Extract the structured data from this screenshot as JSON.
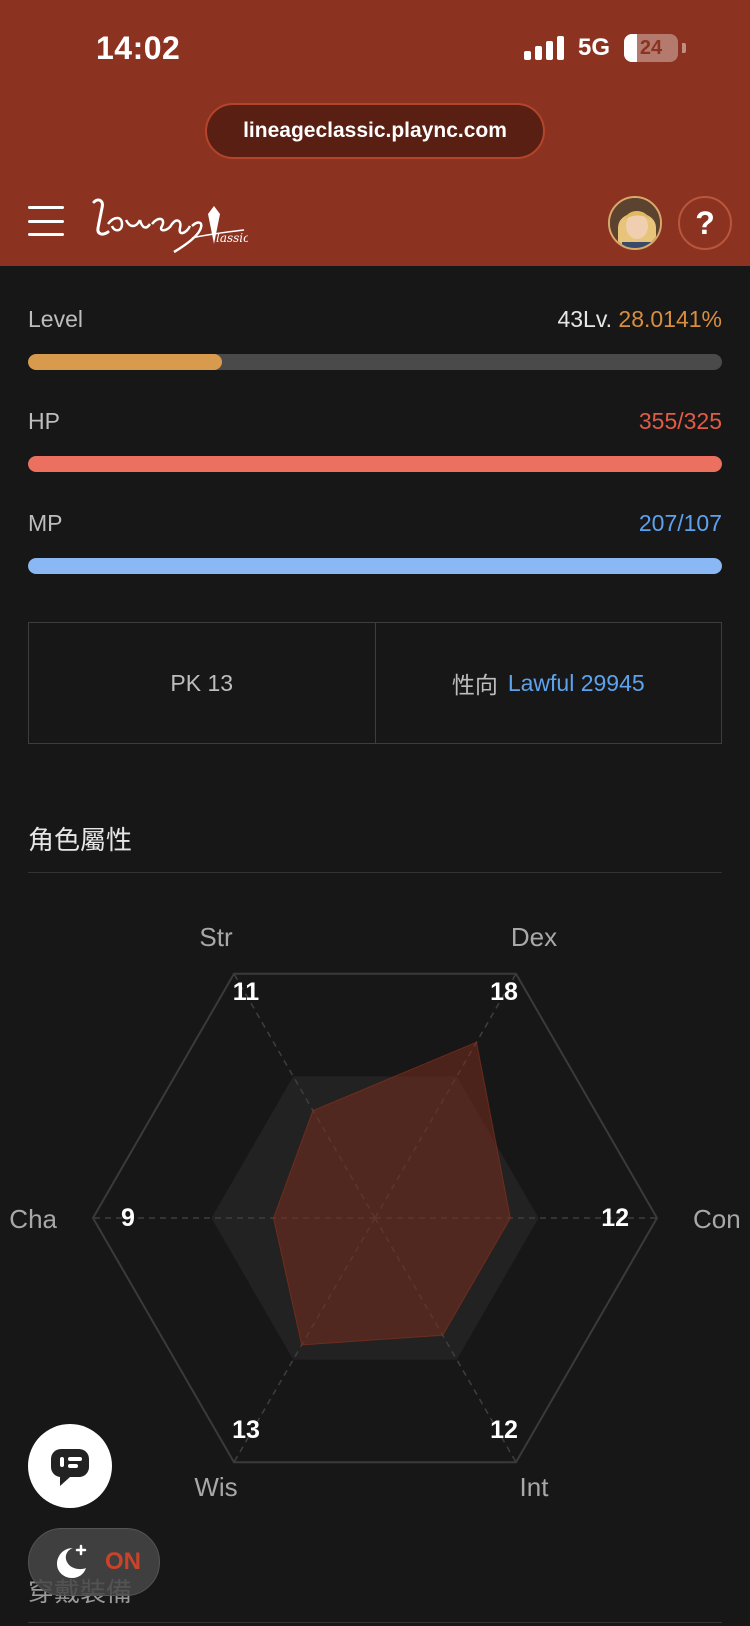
{
  "status_bar": {
    "time": "14:02",
    "network": "5G",
    "battery": "24"
  },
  "browser": {
    "url": "lineageclassic.plaync.com"
  },
  "header": {
    "logo_alt": "Lineage Classic",
    "help_label": "?"
  },
  "stats": {
    "level": {
      "label": "Level",
      "level_text": "43Lv.",
      "percent_text": "28.0141%",
      "progress": 0.280141
    },
    "hp": {
      "label": "HP",
      "value": "355/325",
      "progress": 1.0
    },
    "mp": {
      "label": "MP",
      "value": "207/107",
      "progress": 1.0
    }
  },
  "pk_box": {
    "pk_text": "PK 13",
    "alignment_label": "性向",
    "alignment_value": "Lawful 29945"
  },
  "attributes": {
    "title": "角色屬性",
    "items": [
      {
        "name": "Str",
        "value": 11
      },
      {
        "name": "Dex",
        "value": 18
      },
      {
        "name": "Con",
        "value": 12
      },
      {
        "name": "Int",
        "value": 12
      },
      {
        "name": "Wis",
        "value": 13
      },
      {
        "name": "Cha",
        "value": 9
      }
    ],
    "max": 25
  },
  "next_section": {
    "title": "穿戴裝備"
  },
  "night_mode": {
    "state": "ON"
  },
  "colors": {
    "accent": "#8b3320",
    "level_bar": "#d89a4c",
    "hp_bar": "#ec7060",
    "mp_bar": "#8ab8f4",
    "hp_text": "#e25b46",
    "mp_text": "#5ea2ee",
    "level_pct_text": "#d98e3f",
    "lawful_text": "#5ea2ee"
  }
}
